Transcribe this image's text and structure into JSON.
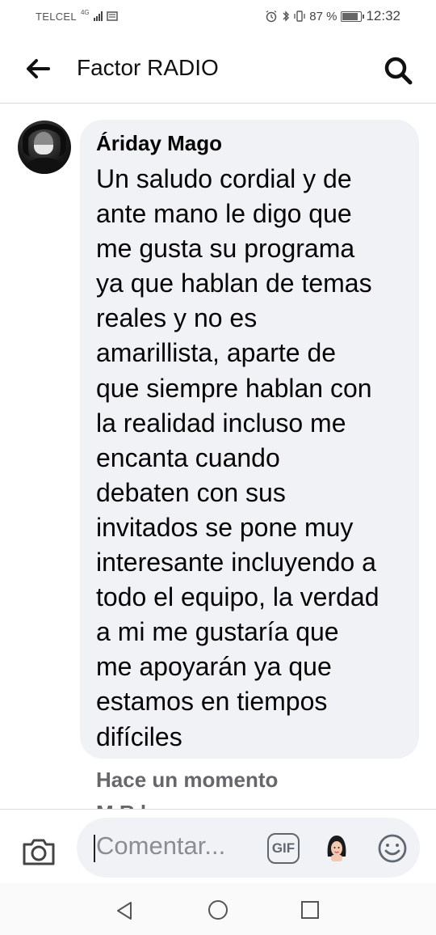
{
  "status_bar": {
    "carrier": "TELCEL",
    "network": "4G",
    "battery_percent": "87 %",
    "battery_level": 0.87,
    "time": "12:32",
    "icons": [
      "sim-card-icon",
      "alarm-icon",
      "bluetooth-icon",
      "vibrate-icon",
      "battery-icon"
    ]
  },
  "header": {
    "title": "Factor RADIO",
    "back_icon": "arrow-left-icon",
    "search_icon": "search-icon"
  },
  "comment": {
    "author": "Áriday Mago",
    "text": "Un saludo cordial y de ante mano le digo que me gusta su programa ya que hablan de temas reales y no es amarillista, aparte de que siempre hablan con la realidad incluso me encanta cuando debaten con sus invitados se pone muy interesante incluyendo a todo el equipo, la verdad a mi me gustaría que me apoyarán ya que estamos en tiempos difíciles",
    "lines": [
      "Un saludo cordial y de",
      "ante mano le digo que",
      "me gusta su programa",
      "ya que hablan de temas",
      "reales y no es",
      "amarillista, aparte de",
      "que siempre hablan con",
      "la realidad incluso me",
      "encanta cuando",
      "debaten con sus",
      "invitados se pone muy",
      "interesante incluyendo a",
      "todo el equipo, la verdad",
      "a mi me gustaría que",
      "me apoyarán ya que",
      "estamos en tiempos",
      "difíciles"
    ],
    "timestamp": "Hace un momento",
    "next_comment_partial": "M                 R           l"
  },
  "composer": {
    "placeholder": "Comentar...",
    "gif_label": "GIF",
    "camera_icon": "camera-icon",
    "avatar_sticker_icon": "avatar-sticker-icon",
    "emoji_icon": "smiley-icon"
  },
  "nav_bar": {
    "back_icon": "nav-back-icon",
    "home_icon": "nav-home-icon",
    "recent_icon": "nav-recent-icon"
  },
  "colors": {
    "bubble": "#f0f2f5",
    "text": "#050505",
    "secondary": "#65676b"
  }
}
